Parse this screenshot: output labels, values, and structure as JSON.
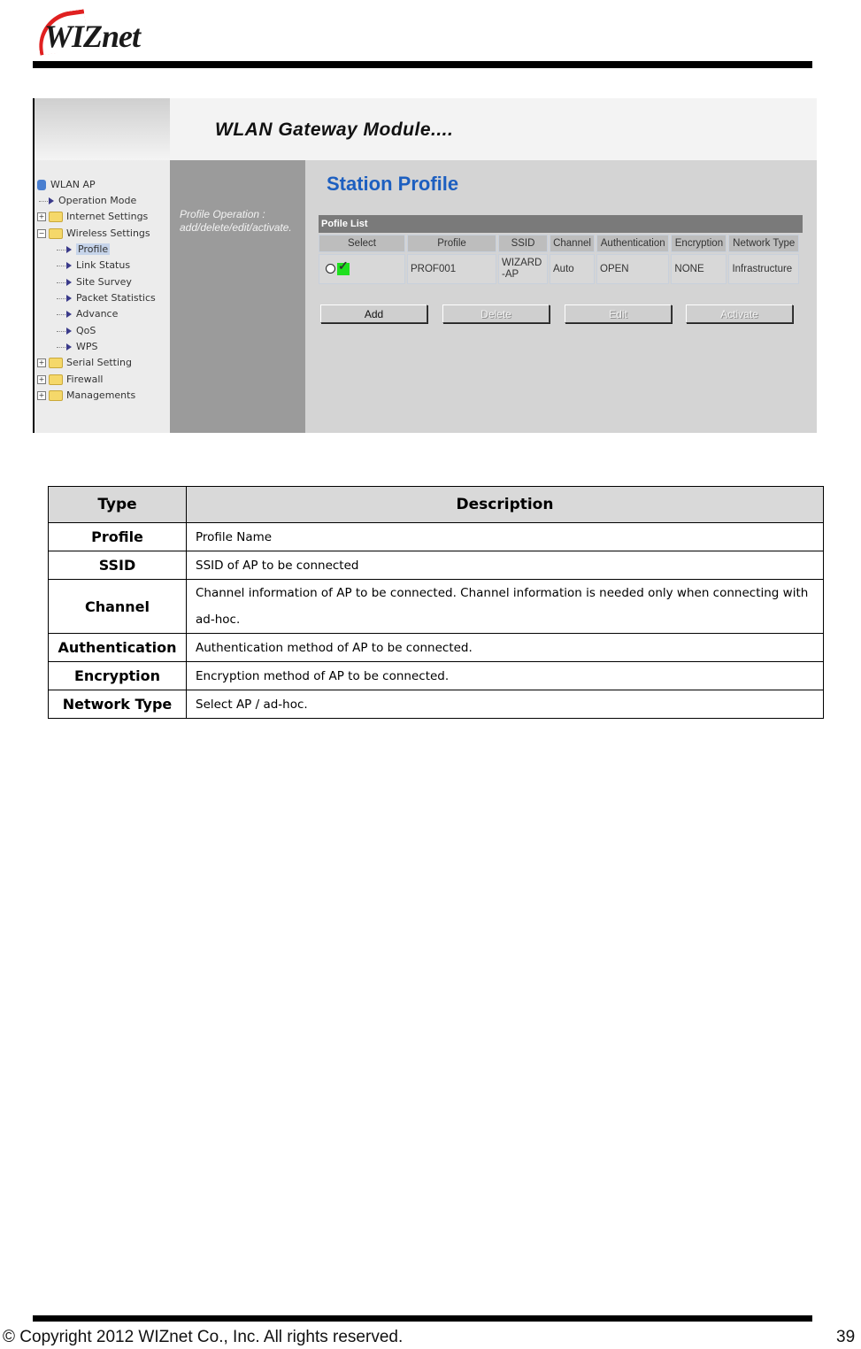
{
  "header": {
    "logo_text": "WIZnet"
  },
  "screenshot": {
    "banner_title": "WLAN Gateway Module....",
    "nav": {
      "root": "WLAN AP",
      "items": [
        {
          "label": "Operation Mode",
          "type": "leaf",
          "level": 1
        },
        {
          "label": "Internet Settings",
          "type": "folder",
          "expanded": false
        },
        {
          "label": "Wireless Settings",
          "type": "folder",
          "expanded": true
        },
        {
          "label": "Profile",
          "type": "leaf",
          "level": 2,
          "selected": true
        },
        {
          "label": "Link Status",
          "type": "leaf",
          "level": 2
        },
        {
          "label": "Site Survey",
          "type": "leaf",
          "level": 2
        },
        {
          "label": "Packet Statistics",
          "type": "leaf",
          "level": 2
        },
        {
          "label": "Advance",
          "type": "leaf",
          "level": 2
        },
        {
          "label": "QoS",
          "type": "leaf",
          "level": 2
        },
        {
          "label": "WPS",
          "type": "leaf",
          "level": 2
        },
        {
          "label": "Serial Setting",
          "type": "folder",
          "expanded": false
        },
        {
          "label": "Firewall",
          "type": "folder",
          "expanded": false
        },
        {
          "label": "Managements",
          "type": "folder",
          "expanded": false
        }
      ]
    },
    "note_line1": "Profile Operation :",
    "note_line2": "add/delete/edit/activate.",
    "page_title": "Station Profile",
    "profile_list": {
      "title": "Pofile List",
      "columns": [
        "Select",
        "Profile",
        "SSID",
        "Channel",
        "Authentication",
        "Encryption",
        "Network Type"
      ],
      "rows": [
        {
          "profile": "PROF001",
          "ssid": "WIZARD-AP",
          "channel": "Auto",
          "authentication": "OPEN",
          "encryption": "NONE",
          "network_type": "Infrastructure",
          "active": true
        }
      ]
    },
    "buttons": [
      {
        "label": "Add",
        "enabled": true
      },
      {
        "label": "Delete",
        "enabled": false
      },
      {
        "label": "Edit",
        "enabled": false
      },
      {
        "label": "Activate",
        "enabled": false
      }
    ]
  },
  "description_table": {
    "headers": [
      "Type",
      "Description"
    ],
    "rows": [
      {
        "type": "Profile",
        "description": "Profile Name"
      },
      {
        "type": "SSID",
        "description": "SSID of AP to be connected"
      },
      {
        "type": "Channel",
        "description": "Channel information of AP to be connected. Channel information is needed only when connecting with ad-hoc."
      },
      {
        "type": "Authentication",
        "description": "Authentication method of AP to be connected."
      },
      {
        "type": "Encryption",
        "description": "Encryption method of AP to be connected."
      },
      {
        "type": "Network Type",
        "description": "Select AP / ad-hoc."
      }
    ]
  },
  "footer": {
    "copyright": "© Copyright 2012 WIZnet Co., Inc. All rights reserved.",
    "page_number": "39"
  }
}
